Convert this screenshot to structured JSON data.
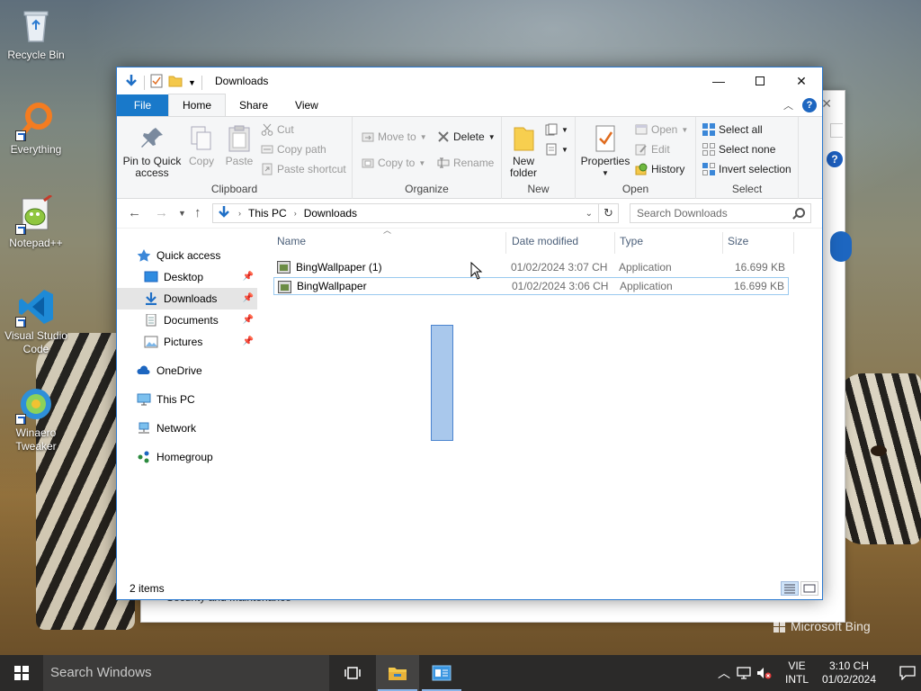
{
  "desktop": {
    "icons": [
      {
        "label": "Recycle Bin"
      },
      {
        "label": "Everything"
      },
      {
        "label": "Notepad++"
      },
      {
        "label": "Visual Studio Code"
      },
      {
        "label": "Winaero Tweaker"
      }
    ],
    "bg_window_text": "Security and Maintenance",
    "watermark": "Microsoft Bing"
  },
  "explorer": {
    "title": "Downloads",
    "tabs": {
      "file": "File",
      "home": "Home",
      "share": "Share",
      "view": "View"
    },
    "ribbon": {
      "clipboard": {
        "label": "Clipboard",
        "pin": "Pin to Quick access",
        "copy": "Copy",
        "paste": "Paste",
        "cut": "Cut",
        "copy_path": "Copy path",
        "paste_shortcut": "Paste shortcut"
      },
      "organize": {
        "label": "Organize",
        "move_to": "Move to",
        "copy_to": "Copy to",
        "delete": "Delete",
        "rename": "Rename"
      },
      "new": {
        "label": "New",
        "new_folder": "New folder"
      },
      "open": {
        "label": "Open",
        "properties": "Properties",
        "open": "Open",
        "edit": "Edit",
        "history": "History"
      },
      "select": {
        "label": "Select",
        "select_all": "Select all",
        "select_none": "Select none",
        "invert": "Invert selection"
      }
    },
    "address": {
      "crumbs": [
        "This PC",
        "Downloads"
      ],
      "search_placeholder": "Search Downloads"
    },
    "nav": {
      "quick_access": "Quick access",
      "desktop": "Desktop",
      "downloads": "Downloads",
      "documents": "Documents",
      "pictures": "Pictures",
      "onedrive": "OneDrive",
      "this_pc": "This PC",
      "network": "Network",
      "homegroup": "Homegroup"
    },
    "columns": {
      "name": "Name",
      "date": "Date modified",
      "type": "Type",
      "size": "Size"
    },
    "files": [
      {
        "name": "BingWallpaper (1)",
        "date": "01/02/2024 3:07 CH",
        "type": "Application",
        "size": "16.699 KB"
      },
      {
        "name": "BingWallpaper",
        "date": "01/02/2024 3:06 CH",
        "type": "Application",
        "size": "16.699 KB"
      }
    ],
    "status": "2 items"
  },
  "taskbar": {
    "search_placeholder": "Search Windows",
    "lang_top": "VIE",
    "lang_bottom": "INTL",
    "time": "3:10 CH",
    "date": "01/02/2024"
  },
  "colors": {
    "accent": "#1979ca",
    "selection_border": "#99c9ef",
    "taskbar": "#2b2a29"
  }
}
